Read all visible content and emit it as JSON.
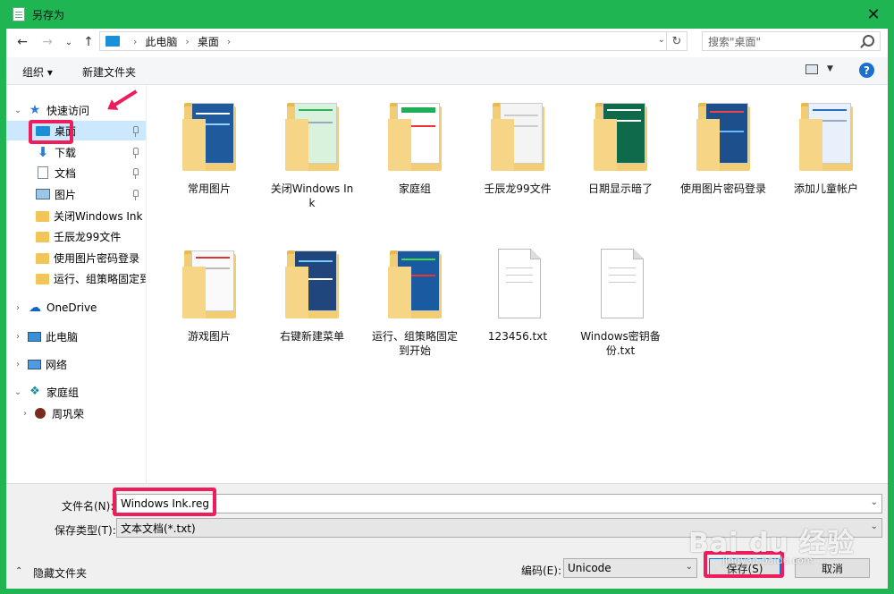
{
  "window": {
    "title": "另存为",
    "close_glyph": "✕"
  },
  "address": {
    "back_glyph": "←",
    "forward_glyph": "→",
    "dropdown_glyph": "⌄",
    "up_glyph": "↑",
    "crumbs": [
      "此电脑",
      "桌面"
    ],
    "crumb_sep": "›",
    "dropdown": "⌄",
    "refresh": "↻"
  },
  "search": {
    "placeholder": "搜索\"桌面\""
  },
  "toolbar": {
    "organize": "组织 ▾",
    "new_folder": "新建文件夹",
    "help": "?"
  },
  "navpane": {
    "items": [
      {
        "label": "快速访问",
        "icon": "star-icon"
      },
      {
        "label": "桌面",
        "icon": "desktop-icon"
      },
      {
        "label": "下载",
        "icon": "download-icon"
      },
      {
        "label": "文档",
        "icon": "document-icon"
      },
      {
        "label": "图片",
        "icon": "pictures-icon"
      },
      {
        "label": "关闭Windows Ink",
        "icon": "folder-icon"
      },
      {
        "label": "壬辰龙99文件",
        "icon": "folder-icon"
      },
      {
        "label": "使用图片密码登录",
        "icon": "folder-icon"
      },
      {
        "label": "运行、组策略固定到",
        "icon": "folder-icon"
      },
      {
        "label": "OneDrive",
        "icon": "cloud-icon"
      },
      {
        "label": "此电脑",
        "icon": "pc-icon"
      },
      {
        "label": "网络",
        "icon": "network-icon"
      },
      {
        "label": "家庭组",
        "icon": "homegroup-icon"
      },
      {
        "label": "周巩荣",
        "icon": "user-icon"
      }
    ]
  },
  "files": [
    {
      "name": "常用图片",
      "type": "folder"
    },
    {
      "name": "关闭Windows Ink",
      "type": "folder"
    },
    {
      "name": "家庭组",
      "type": "folder"
    },
    {
      "name": "壬辰龙99文件",
      "type": "folder"
    },
    {
      "name": "日期显示暗了",
      "type": "folder"
    },
    {
      "name": "使用图片密码登录",
      "type": "folder"
    },
    {
      "name": "添加儿童帐户",
      "type": "folder"
    },
    {
      "name": "游戏图片",
      "type": "folder"
    },
    {
      "name": "右键新建菜单",
      "type": "folder"
    },
    {
      "name": "运行、组策略固定到开始",
      "type": "folder"
    },
    {
      "name": "123456.txt",
      "type": "text"
    },
    {
      "name": "Windows密钥备份.txt",
      "type": "text"
    }
  ],
  "bottom": {
    "filename_label": "文件名(N):",
    "filename_value": "Windows Ink.reg",
    "savetype_label": "保存类型(T):",
    "savetype_value": "文本文档(*.txt)",
    "dropdown_glyph": "⌄",
    "hide_folders": "隐藏文件夹",
    "encoding_label": "编码(E):",
    "encoding_value": "Unicode",
    "save_button": "保存(S)",
    "cancel_button": "取消"
  },
  "watermark": {
    "logo": "Bai du 经验",
    "url": "jingyan.baidu.com"
  },
  "colors": {
    "accent": "#1fb552",
    "highlight": "#ee1e5c",
    "selection": "#cce8ff"
  }
}
